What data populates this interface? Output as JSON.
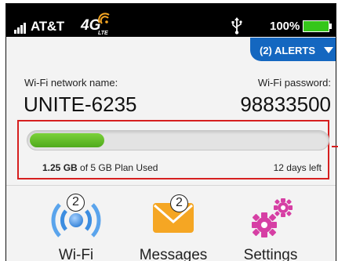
{
  "status_bar": {
    "carrier": "AT&T",
    "network": "4G",
    "network_sub": "LTE",
    "battery_percent": "100%",
    "battery_level": 1.0
  },
  "alerts": {
    "label": "(2) ALERTS"
  },
  "wifi": {
    "name_label": "Wi-Fi network name:",
    "name": "UNITE-6235",
    "password_label": "Wi-Fi password:",
    "password": "98833500"
  },
  "usage": {
    "used": "1.25 GB",
    "plan": "of 5 GB Plan Used",
    "days_left": "12 days left",
    "fraction_used": 0.25
  },
  "apps": [
    {
      "label": "Wi-Fi",
      "badge": "2",
      "icon": "wifi-icon"
    },
    {
      "label": "Messages",
      "badge": "2",
      "icon": "envelope-icon"
    },
    {
      "label": "Settings",
      "icon": "gears-icon"
    }
  ],
  "colors": {
    "status_bar_bg": "#000000",
    "alerts_bg": "#1467c0",
    "progress_green": "#5cb82a",
    "highlight_red": "#d61f1f",
    "envelope_orange": "#f5a623",
    "gear_magenta": "#d63fa4",
    "wifi_blue": "#3c8de0"
  }
}
